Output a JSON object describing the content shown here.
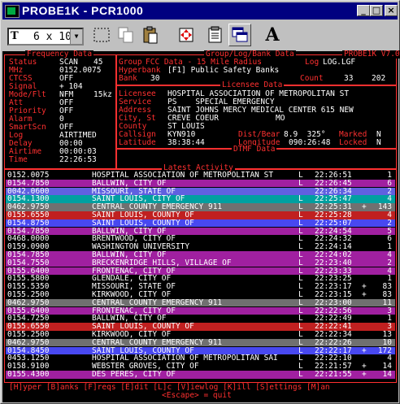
{
  "window": {
    "title": "PROBE1K - PCR1000",
    "controls": {
      "minimize": "_",
      "maximize": "□",
      "close": "×"
    }
  },
  "toolbar": {
    "font_label": "6 x 10",
    "font_prefix": "T"
  },
  "frequency_data": {
    "title": "Frequency Data",
    "fields": [
      {
        "label": "Status",
        "value": "SCAN",
        "extra": "45"
      },
      {
        "label": "MHz",
        "value": "0152.0075",
        "extra": ""
      },
      {
        "label": "CTCSS",
        "value": "OFF",
        "extra": ""
      },
      {
        "label": "Signal",
        "value": "+ 104",
        "extra": ""
      },
      {
        "label": "Mode/Flt",
        "value": "NFM",
        "extra": "15kz"
      },
      {
        "label": "Att",
        "value": "OFF",
        "extra": ""
      },
      {
        "label": "Priority",
        "value": "OFF",
        "extra": ""
      },
      {
        "label": "Alarm",
        "value": "0",
        "extra": ""
      },
      {
        "label": "SmartScn",
        "value": "OFF",
        "extra": ""
      },
      {
        "label": "Log",
        "value": "AIRTIMED",
        "extra": ""
      },
      {
        "label": "Delay",
        "value": "00:00",
        "extra": ""
      },
      {
        "label": "Airtime",
        "value": "00:00:03",
        "extra": ""
      },
      {
        "label": "Time",
        "value": "22:26:53",
        "extra": ""
      }
    ]
  },
  "group_data": {
    "title": "Group/Log/Bank Data",
    "version": "PROBE1K V7.0",
    "group_label": "Group",
    "group_value": "FCC Data - 15 Mile Radius",
    "log_label": "Log",
    "log_value": "LOG.LGF",
    "hyperbank_label": "Hyperbank",
    "hyperbank_value": "[F1] Public Safety Banks",
    "bank_label": "Bank",
    "bank_value": "30",
    "count_label": "Count",
    "count_value": "33",
    "count_total": "202"
  },
  "licensee_data": {
    "title": "Licensee Data",
    "licensee_label": "Licensee",
    "licensee_value": "HOSPITAL ASSOCIATION OF METROPOLITAN ST",
    "service_label": "Service",
    "service_value": "PS    SPECIAL EMERGENCY",
    "address_label": "Address",
    "address_value": "SAINT JOHNS MERCY MEDICAL CENTER 615 NEW",
    "city_label": "City, St",
    "city_value": "CREVE COEUR",
    "state_value": "MO",
    "county_label": "County",
    "county_value": "ST LOUIS",
    "callsign_label": "Callsign",
    "callsign_value": "KYN910",
    "dist_label": "Dist/Bear",
    "dist_value": "8.9  325°",
    "marked_label": "Marked",
    "marked_value": "N",
    "latitude_label": "Latitude",
    "latitude_value": "38:38:44",
    "longitude_label": "Longitude",
    "longitude_value": "090:26:48",
    "locked_label": "Locked",
    "locked_value": "N"
  },
  "dtmf": {
    "title": "DTMF Data"
  },
  "activity": {
    "title": "Latest Activity",
    "rows": [
      {
        "freq": "0152.0075",
        "name": "HOSPITAL ASSOCIATION OF METROPOLITAN ST",
        "flag": "L",
        "time": "22:26:51",
        "plus": "",
        "count": "1",
        "bg": "#000000"
      },
      {
        "freq": "0154.7850",
        "name": "BALLWIN, CITY OF",
        "flag": "L",
        "time": "22:26:45",
        "plus": "",
        "count": "6",
        "bg": "#a020a0"
      },
      {
        "freq": "0042.0600",
        "name": "MISSOURI, STATE OF",
        "flag": "",
        "time": "22:26:34",
        "plus": "",
        "count": "2",
        "bg": "#6060e0"
      },
      {
        "freq": "0154.1300",
        "name": "SAINT LOUIS, CITY OF",
        "flag": "L",
        "time": "22:25:47",
        "plus": "",
        "count": "4",
        "bg": "#00a0a0"
      },
      {
        "freq": "0462.9750",
        "name": "CENTRAL COUNTY EMERGENCY 911",
        "flag": "L",
        "time": "22:25:31",
        "plus": "+",
        "count": "143",
        "bg": "#707070"
      },
      {
        "freq": "0155.6550",
        "name": "SAINT LOUIS, COUNTY OF",
        "flag": "L",
        "time": "22:25:28",
        "plus": "",
        "count": "4",
        "bg": "#c02020"
      },
      {
        "freq": "0154.8750",
        "name": "SAINT LOUIS, COUNTY OF",
        "flag": "L",
        "time": "22:25:07",
        "plus": "",
        "count": "2",
        "bg": "#4848f0"
      },
      {
        "freq": "0154.7850",
        "name": "BALLWIN, CITY OF",
        "flag": "L",
        "time": "22:24:54",
        "plus": "",
        "count": "5",
        "bg": "#a020a0"
      },
      {
        "freq": "0468.0000",
        "name": "BRENTWOOD, CITY OF",
        "flag": "L",
        "time": "22:24:32",
        "plus": "",
        "count": "6",
        "bg": "#000000"
      },
      {
        "freq": "0159.0900",
        "name": "WASHINGTON UNIVERSITY",
        "flag": "L",
        "time": "22:24:14",
        "plus": "",
        "count": "1",
        "bg": "#000000"
      },
      {
        "freq": "0154.7850",
        "name": "BALLWIN, CITY OF",
        "flag": "L",
        "time": "22:24:02",
        "plus": "",
        "count": "4",
        "bg": "#a020a0"
      },
      {
        "freq": "0154.7550",
        "name": "BRECKENRIDGE HILLS, VILLAGE OF",
        "flag": "L",
        "time": "22:23:40",
        "plus": "",
        "count": "2",
        "bg": "#a020a0"
      },
      {
        "freq": "0155.6400",
        "name": "FRONTENAC, CITY OF",
        "flag": "L",
        "time": "22:23:33",
        "plus": "",
        "count": "4",
        "bg": "#a020a0"
      },
      {
        "freq": "0155.5800",
        "name": "GLENDALE, CITY OF",
        "flag": "L",
        "time": "22:23:25",
        "plus": "",
        "count": "1",
        "bg": "#000000"
      },
      {
        "freq": "0155.5350",
        "name": "MISSOURI, STATE OF",
        "flag": "L",
        "time": "22:23:17",
        "plus": "+",
        "count": "83",
        "bg": "#000000"
      },
      {
        "freq": "0155.2500",
        "name": "KIRKWOOD, CITY OF",
        "flag": "L",
        "time": "22:23:15",
        "plus": "+",
        "count": "83",
        "bg": "#000000"
      },
      {
        "freq": "0462.9750",
        "name": "CENTRAL COUNTY EMERGENCY 911",
        "flag": "L",
        "time": "22:23:00",
        "plus": "",
        "count": "11",
        "bg": "#707070"
      },
      {
        "freq": "0155.6400",
        "name": "FRONTENAC, CITY OF",
        "flag": "L",
        "time": "22:22:56",
        "plus": "",
        "count": "3",
        "bg": "#a020a0"
      },
      {
        "freq": "0154.7250",
        "name": "BALLWIN, CITY OF",
        "flag": "L",
        "time": "22:22:49",
        "plus": "",
        "count": "1",
        "bg": "#000000"
      },
      {
        "freq": "0155.6550",
        "name": "SAINT LOUIS, COUNTY OF",
        "flag": "L",
        "time": "22:22:41",
        "plus": "",
        "count": "3",
        "bg": "#c02020"
      },
      {
        "freq": "0155.2500",
        "name": "KIRKWOOD, CITY OF",
        "flag": "L",
        "time": "22:22:34",
        "plus": "",
        "count": "13",
        "bg": "#000000"
      },
      {
        "freq": "0462.9750",
        "name": "CENTRAL COUNTY EMERGENCY 911",
        "flag": "L",
        "time": "22:22:26",
        "plus": "",
        "count": "10",
        "bg": "#707070"
      },
      {
        "freq": "0154.8450",
        "name": "SAINT LOUIS, COUNTY OF",
        "flag": "L",
        "time": "22:22:17",
        "plus": "+",
        "count": "172",
        "bg": "#4848f0"
      },
      {
        "freq": "0453.1250",
        "name": "HOSPITAL ASSOCIATION OF METROPOLITAN SAI",
        "flag": "L",
        "time": "22:22:10",
        "plus": "",
        "count": "4",
        "bg": "#000000"
      },
      {
        "freq": "0158.9100",
        "name": "WEBSTER GROVES, CITY OF",
        "flag": "L",
        "time": "22:21:57",
        "plus": "+",
        "count": "14",
        "bg": "#000000"
      },
      {
        "freq": "0155.4300",
        "name": "DES PERES, CITY OF",
        "flag": "L",
        "time": "22:21:55",
        "plus": "+",
        "count": "14",
        "bg": "#a020a0"
      }
    ]
  },
  "footer": {
    "menu_line": "[H]yper [B]anks [F]reqs [E]dit [L]c [V]iewlog [K]ill [S]ettings [M]an",
    "escape_line": "<Escape> = quit"
  },
  "colors": {
    "accent": "#ff3030",
    "titlebar": "#000080"
  }
}
